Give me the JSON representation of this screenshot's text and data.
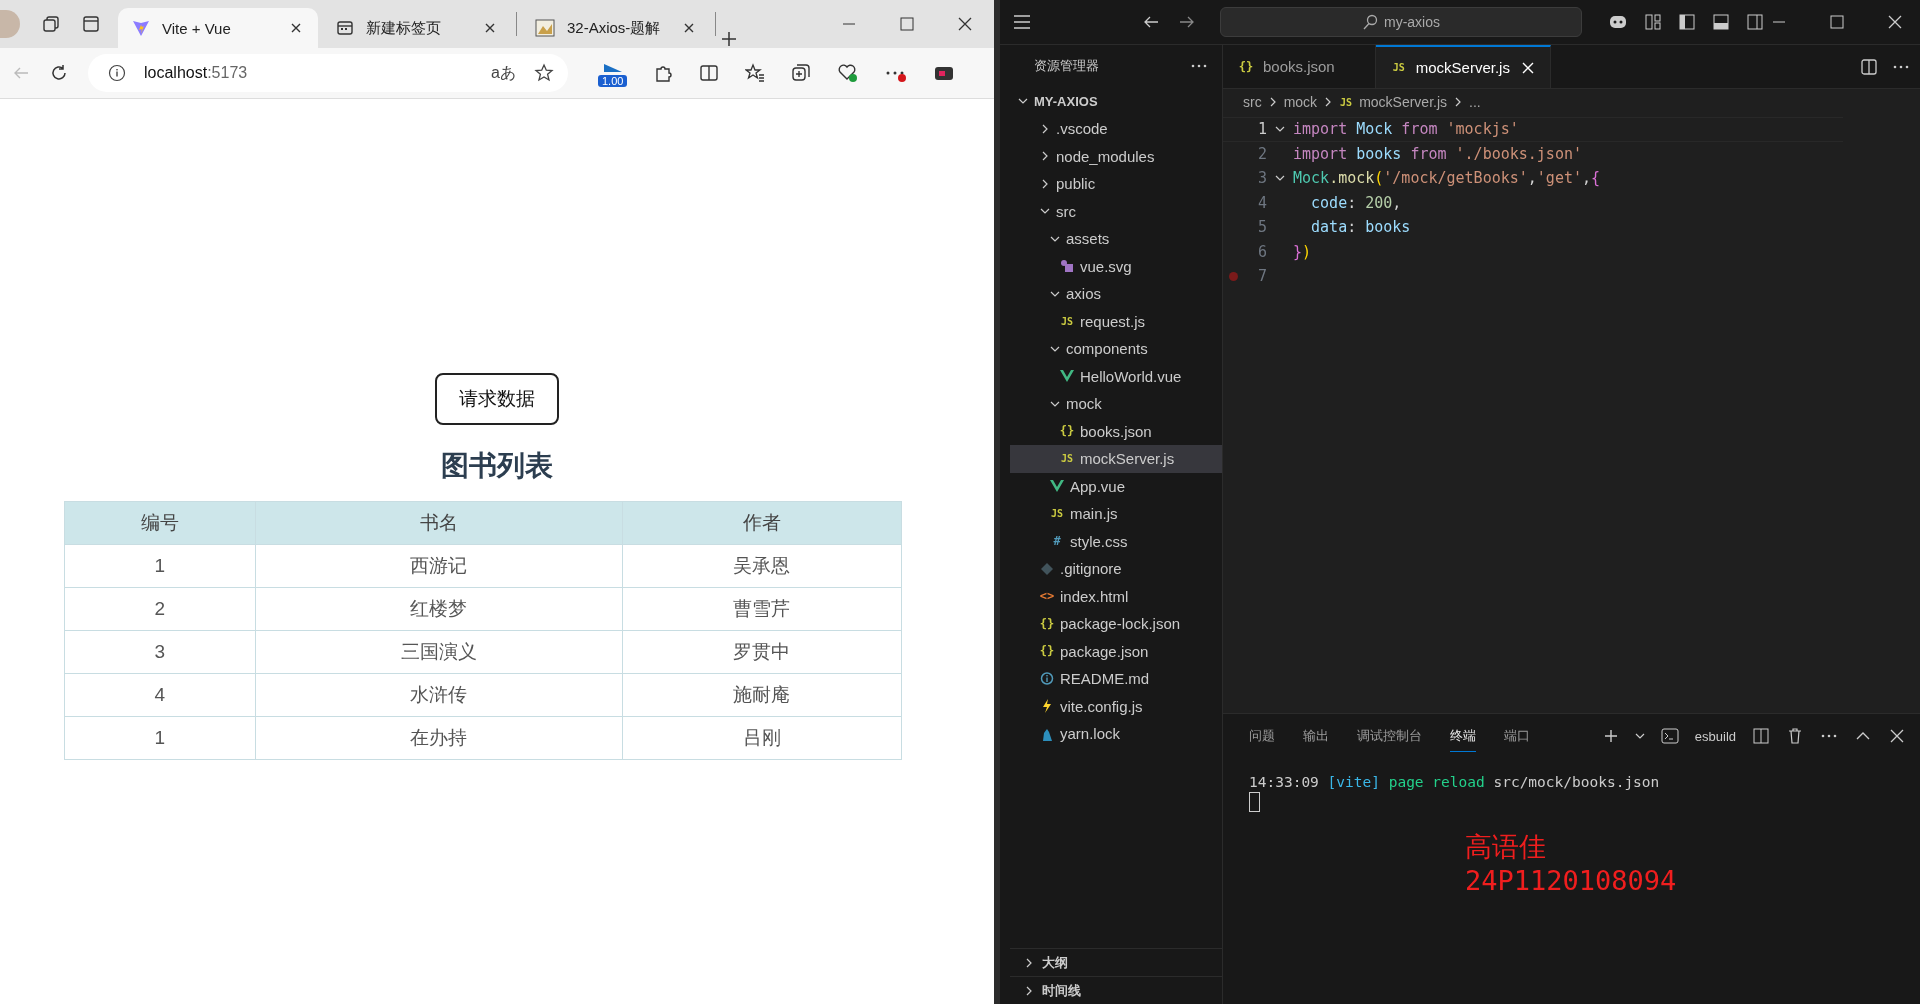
{
  "browser": {
    "tabs": [
      {
        "title": "Vite + Vue",
        "kind": "vite",
        "selected": true
      },
      {
        "title": "新建标签页",
        "kind": "newtab",
        "selected": false
      },
      {
        "title": "32-Axios-题解",
        "kind": "image",
        "selected": false
      }
    ],
    "address": {
      "host": "localhost",
      "port": ":5173"
    },
    "translate_glyph": "aあ",
    "zoom_badge": "1.00",
    "page": {
      "button": "请求数据",
      "heading": "图书列表",
      "columns": [
        "编号",
        "书名",
        "作者"
      ],
      "rows": [
        [
          "1",
          "西游记",
          "吴承恩"
        ],
        [
          "2",
          "红楼梦",
          "曹雪芹"
        ],
        [
          "3",
          "三国演义",
          "罗贯中"
        ],
        [
          "4",
          "水浒传",
          "施耐庵"
        ],
        [
          "1",
          "在办持",
          "吕刚"
        ]
      ]
    }
  },
  "vscode": {
    "search": "my-axios",
    "explorer_title": "资源管理器",
    "root": "MY-AXIOS",
    "tree": [
      {
        "name": ".vscode",
        "kind": "folder",
        "expanded": false,
        "selected": false
      },
      {
        "name": "node_modules",
        "kind": "folder",
        "expanded": false,
        "selected": false
      },
      {
        "name": "public",
        "kind": "folder",
        "expanded": false,
        "selected": false
      },
      {
        "name": "src",
        "kind": "folder",
        "expanded": true,
        "selected": false,
        "children": [
          {
            "name": "assets",
            "kind": "folder",
            "expanded": true,
            "selected": false,
            "children": [
              {
                "name": "vue.svg",
                "kind": "svg",
                "selected": false
              }
            ]
          },
          {
            "name": "axios",
            "kind": "folder",
            "expanded": true,
            "selected": false,
            "children": [
              {
                "name": "request.js",
                "kind": "js",
                "icon": "JS",
                "selected": false
              }
            ]
          },
          {
            "name": "components",
            "kind": "folder",
            "expanded": true,
            "selected": false,
            "children": [
              {
                "name": "HelloWorld.vue",
                "kind": "vue",
                "selected": false
              }
            ]
          },
          {
            "name": "mock",
            "kind": "folder",
            "expanded": true,
            "selected": false,
            "children": [
              {
                "name": "books.json",
                "kind": "json",
                "icon": "{}",
                "selected": false
              },
              {
                "name": "mockServer.js",
                "kind": "js",
                "icon": "JS",
                "selected": true
              }
            ]
          },
          {
            "name": "App.vue",
            "kind": "vue",
            "selected": false
          },
          {
            "name": "main.js",
            "kind": "js",
            "icon": "JS",
            "selected": false
          },
          {
            "name": "style.css",
            "kind": "css",
            "icon": "#",
            "selected": false
          }
        ]
      },
      {
        "name": ".gitignore",
        "kind": "git",
        "selected": false
      },
      {
        "name": "index.html",
        "kind": "html",
        "icon": "<>",
        "selected": false
      },
      {
        "name": "package-lock.json",
        "kind": "json",
        "icon": "{}",
        "selected": false
      },
      {
        "name": "package.json",
        "kind": "json",
        "icon": "{}",
        "selected": false
      },
      {
        "name": "README.md",
        "kind": "info",
        "selected": false
      },
      {
        "name": "vite.config.js",
        "kind": "vite",
        "selected": false
      },
      {
        "name": "yarn.lock",
        "kind": "yarn",
        "selected": false
      }
    ],
    "sections": [
      "大纲",
      "时间线"
    ],
    "tabs": [
      {
        "title": "books.json",
        "kind": "json",
        "icon": "{}",
        "selected": false
      },
      {
        "title": "mockServer.js",
        "kind": "js",
        "icon": "JS",
        "selected": true
      }
    ],
    "breadcrumb": [
      {
        "text": "src",
        "kind": "folder"
      },
      {
        "text": "mock",
        "kind": "folder"
      },
      {
        "text": "mockServer.js",
        "kind": "js",
        "icon": "JS"
      },
      {
        "text": "...",
        "kind": "folder"
      }
    ],
    "code": [
      {
        "number": "1",
        "current": true,
        "foldable": true,
        "breakpoint": false,
        "tokens": [
          {
            "text": "import",
            "color": "#c586c0"
          },
          {
            "text": " Mock",
            "color": "#9cdcfe"
          },
          {
            "text": " from",
            "color": "#c586c0"
          },
          {
            "text": " 'mockjs'",
            "color": "#ce9178"
          }
        ]
      },
      {
        "number": "2",
        "current": false,
        "foldable": false,
        "breakpoint": false,
        "tokens": [
          {
            "text": "import",
            "color": "#c586c0"
          },
          {
            "text": " books",
            "color": "#9cdcfe"
          },
          {
            "text": " from",
            "color": "#c586c0"
          },
          {
            "text": " './books.json'",
            "color": "#ce9178"
          }
        ]
      },
      {
        "number": "3",
        "current": false,
        "foldable": true,
        "breakpoint": false,
        "tokens": [
          {
            "text": "Mock",
            "color": "#4ec9b0"
          },
          {
            "text": ".mock",
            "color": "#dcdcaa"
          },
          {
            "text": "(",
            "color": "#ffd700"
          },
          {
            "text": "'/mock/getBooks'",
            "color": "#ce9178"
          },
          {
            "text": ",",
            "color": "#d4d4d4"
          },
          {
            "text": "'get'",
            "color": "#ce9178"
          },
          {
            "text": ",",
            "color": "#d4d4d4"
          },
          {
            "text": "{",
            "color": "#da70d6"
          }
        ]
      },
      {
        "number": "4",
        "current": false,
        "foldable": false,
        "breakpoint": false,
        "tokens": [
          {
            "text": "  code",
            "color": "#9cdcfe"
          },
          {
            "text": ":",
            "color": "#d4d4d4"
          },
          {
            "text": " 200",
            "color": "#b5cea8"
          },
          {
            "text": ",",
            "color": "#d4d4d4"
          }
        ]
      },
      {
        "number": "5",
        "current": false,
        "foldable": false,
        "breakpoint": false,
        "tokens": [
          {
            "text": "  data",
            "color": "#9cdcfe"
          },
          {
            "text": ":",
            "color": "#d4d4d4"
          },
          {
            "text": " books",
            "color": "#9cdcfe"
          }
        ]
      },
      {
        "number": "6",
        "current": false,
        "foldable": false,
        "breakpoint": false,
        "tokens": [
          {
            "text": "}",
            "color": "#da70d6"
          },
          {
            "text": ")",
            "color": "#ffd700"
          }
        ]
      },
      {
        "number": "7",
        "current": false,
        "foldable": false,
        "breakpoint": true
      }
    ],
    "panel_tabs": [
      {
        "label": "问题",
        "selected": false
      },
      {
        "label": "输出",
        "selected": false
      },
      {
        "label": "调试控制台",
        "selected": false
      },
      {
        "label": "终端",
        "selected": true
      },
      {
        "label": "端口",
        "selected": false
      }
    ],
    "terminal_profile": "esbuild",
    "terminal_lines": [
      [
        {
          "text": "14:33:09",
          "color": "#cccccc"
        },
        {
          "text": " [vite]",
          "color": "#3ab7e8"
        },
        {
          "text": " page reload",
          "color": "#23d18b"
        },
        {
          "text": " src/mock/books.json",
          "color": "#cccccc"
        }
      ]
    ],
    "overlay_note": [
      "高语佳",
      "24P1120108094"
    ]
  }
}
